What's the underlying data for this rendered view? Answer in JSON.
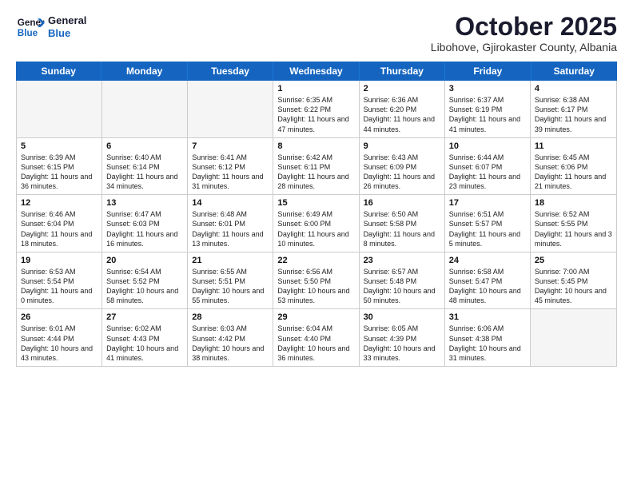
{
  "header": {
    "logo_line1": "General",
    "logo_line2": "Blue",
    "month": "October 2025",
    "location": "Libohove, Gjirokaster County, Albania"
  },
  "weekdays": [
    "Sunday",
    "Monday",
    "Tuesday",
    "Wednesday",
    "Thursday",
    "Friday",
    "Saturday"
  ],
  "rows": [
    [
      {
        "day": "",
        "text": ""
      },
      {
        "day": "",
        "text": ""
      },
      {
        "day": "",
        "text": ""
      },
      {
        "day": "1",
        "text": "Sunrise: 6:35 AM\nSunset: 6:22 PM\nDaylight: 11 hours and 47 minutes."
      },
      {
        "day": "2",
        "text": "Sunrise: 6:36 AM\nSunset: 6:20 PM\nDaylight: 11 hours and 44 minutes."
      },
      {
        "day": "3",
        "text": "Sunrise: 6:37 AM\nSunset: 6:19 PM\nDaylight: 11 hours and 41 minutes."
      },
      {
        "day": "4",
        "text": "Sunrise: 6:38 AM\nSunset: 6:17 PM\nDaylight: 11 hours and 39 minutes."
      }
    ],
    [
      {
        "day": "5",
        "text": "Sunrise: 6:39 AM\nSunset: 6:15 PM\nDaylight: 11 hours and 36 minutes."
      },
      {
        "day": "6",
        "text": "Sunrise: 6:40 AM\nSunset: 6:14 PM\nDaylight: 11 hours and 34 minutes."
      },
      {
        "day": "7",
        "text": "Sunrise: 6:41 AM\nSunset: 6:12 PM\nDaylight: 11 hours and 31 minutes."
      },
      {
        "day": "8",
        "text": "Sunrise: 6:42 AM\nSunset: 6:11 PM\nDaylight: 11 hours and 28 minutes."
      },
      {
        "day": "9",
        "text": "Sunrise: 6:43 AM\nSunset: 6:09 PM\nDaylight: 11 hours and 26 minutes."
      },
      {
        "day": "10",
        "text": "Sunrise: 6:44 AM\nSunset: 6:07 PM\nDaylight: 11 hours and 23 minutes."
      },
      {
        "day": "11",
        "text": "Sunrise: 6:45 AM\nSunset: 6:06 PM\nDaylight: 11 hours and 21 minutes."
      }
    ],
    [
      {
        "day": "12",
        "text": "Sunrise: 6:46 AM\nSunset: 6:04 PM\nDaylight: 11 hours and 18 minutes."
      },
      {
        "day": "13",
        "text": "Sunrise: 6:47 AM\nSunset: 6:03 PM\nDaylight: 11 hours and 16 minutes."
      },
      {
        "day": "14",
        "text": "Sunrise: 6:48 AM\nSunset: 6:01 PM\nDaylight: 11 hours and 13 minutes."
      },
      {
        "day": "15",
        "text": "Sunrise: 6:49 AM\nSunset: 6:00 PM\nDaylight: 11 hours and 10 minutes."
      },
      {
        "day": "16",
        "text": "Sunrise: 6:50 AM\nSunset: 5:58 PM\nDaylight: 11 hours and 8 minutes."
      },
      {
        "day": "17",
        "text": "Sunrise: 6:51 AM\nSunset: 5:57 PM\nDaylight: 11 hours and 5 minutes."
      },
      {
        "day": "18",
        "text": "Sunrise: 6:52 AM\nSunset: 5:55 PM\nDaylight: 11 hours and 3 minutes."
      }
    ],
    [
      {
        "day": "19",
        "text": "Sunrise: 6:53 AM\nSunset: 5:54 PM\nDaylight: 11 hours and 0 minutes."
      },
      {
        "day": "20",
        "text": "Sunrise: 6:54 AM\nSunset: 5:52 PM\nDaylight: 10 hours and 58 minutes."
      },
      {
        "day": "21",
        "text": "Sunrise: 6:55 AM\nSunset: 5:51 PM\nDaylight: 10 hours and 55 minutes."
      },
      {
        "day": "22",
        "text": "Sunrise: 6:56 AM\nSunset: 5:50 PM\nDaylight: 10 hours and 53 minutes."
      },
      {
        "day": "23",
        "text": "Sunrise: 6:57 AM\nSunset: 5:48 PM\nDaylight: 10 hours and 50 minutes."
      },
      {
        "day": "24",
        "text": "Sunrise: 6:58 AM\nSunset: 5:47 PM\nDaylight: 10 hours and 48 minutes."
      },
      {
        "day": "25",
        "text": "Sunrise: 7:00 AM\nSunset: 5:45 PM\nDaylight: 10 hours and 45 minutes."
      }
    ],
    [
      {
        "day": "26",
        "text": "Sunrise: 6:01 AM\nSunset: 4:44 PM\nDaylight: 10 hours and 43 minutes."
      },
      {
        "day": "27",
        "text": "Sunrise: 6:02 AM\nSunset: 4:43 PM\nDaylight: 10 hours and 41 minutes."
      },
      {
        "day": "28",
        "text": "Sunrise: 6:03 AM\nSunset: 4:42 PM\nDaylight: 10 hours and 38 minutes."
      },
      {
        "day": "29",
        "text": "Sunrise: 6:04 AM\nSunset: 4:40 PM\nDaylight: 10 hours and 36 minutes."
      },
      {
        "day": "30",
        "text": "Sunrise: 6:05 AM\nSunset: 4:39 PM\nDaylight: 10 hours and 33 minutes."
      },
      {
        "day": "31",
        "text": "Sunrise: 6:06 AM\nSunset: 4:38 PM\nDaylight: 10 hours and 31 minutes."
      },
      {
        "day": "",
        "text": ""
      }
    ]
  ]
}
